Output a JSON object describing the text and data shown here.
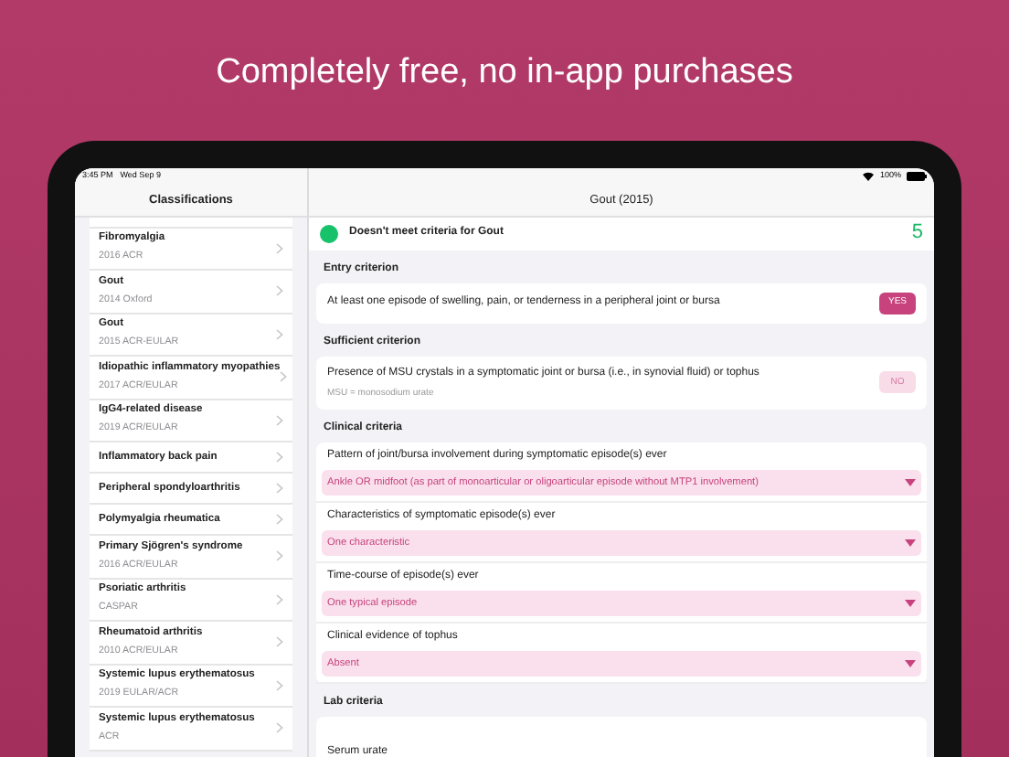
{
  "headline": "Completely free, no in-app purchases",
  "status_bar": {
    "time": "3:45 PM",
    "date": "Wed Sep 9",
    "battery": "100%"
  },
  "sidebar": {
    "title": "Classifications",
    "items": [
      {
        "title": "Fibromyalgia",
        "subtitle": "2016 ACR"
      },
      {
        "title": "Gout",
        "subtitle": "2014 Oxford"
      },
      {
        "title": "Gout",
        "subtitle": "2015 ACR-EULAR"
      },
      {
        "title": "Idiopathic inflammatory myopathies",
        "subtitle": "2017 ACR/EULAR"
      },
      {
        "title": "IgG4-related disease",
        "subtitle": "2019 ACR/EULAR"
      },
      {
        "title": "Inflammatory back pain"
      },
      {
        "title": "Peripheral spondyloarthritis"
      },
      {
        "title": "Polymyalgia rheumatica"
      },
      {
        "title": "Primary Sjögren's syndrome",
        "subtitle": "2016 ACR/EULAR"
      },
      {
        "title": "Psoriatic arthritis",
        "subtitle": "CASPAR"
      },
      {
        "title": "Rheumatoid arthritis",
        "subtitle": "2010 ACR/EULAR"
      },
      {
        "title": "Systemic lupus erythematosus",
        "subtitle": "2019 EULAR/ACR"
      },
      {
        "title": "Systemic lupus erythematosus",
        "subtitle": "ACR"
      }
    ]
  },
  "detail": {
    "title": "Gout (2015)",
    "result": {
      "text": "Doesn't meet criteria for Gout",
      "score": "5"
    },
    "sections": [
      {
        "title": "Entry criterion",
        "items": [
          {
            "kind": "yesno",
            "text": "At least one episode of swelling, pain, or tenderness in a peripheral joint or bursa",
            "answer": {
              "label": "YES",
              "selected": true
            }
          }
        ]
      },
      {
        "title": "Sufficient criterion",
        "items": [
          {
            "kind": "yesno",
            "text": "Presence of MSU crystals in a symptomatic joint or bursa (i.e., in synovial fluid) or tophus",
            "note": "MSU = monosodium urate",
            "answer": {
              "label": "NO",
              "selected": false
            }
          }
        ]
      },
      {
        "title": "Clinical criteria",
        "items": [
          {
            "kind": "select",
            "text": "Pattern of joint/bursa involvement during symptomatic episode(s) ever",
            "value": "Ankle OR midfoot (as part of monoarticular or oligoarticular episode without MTP1 involvement)"
          },
          {
            "kind": "select",
            "text": "Characteristics of symptomatic episode(s) ever",
            "value": "One characteristic"
          },
          {
            "kind": "select",
            "text": "Time-course of episode(s) ever",
            "value": "One typical episode"
          },
          {
            "kind": "select",
            "text": "Clinical evidence of tophus",
            "value": "Absent"
          }
        ]
      },
      {
        "title": "Lab criteria",
        "items": [
          {
            "kind": "label",
            "text": "Serum urate"
          }
        ]
      }
    ]
  }
}
